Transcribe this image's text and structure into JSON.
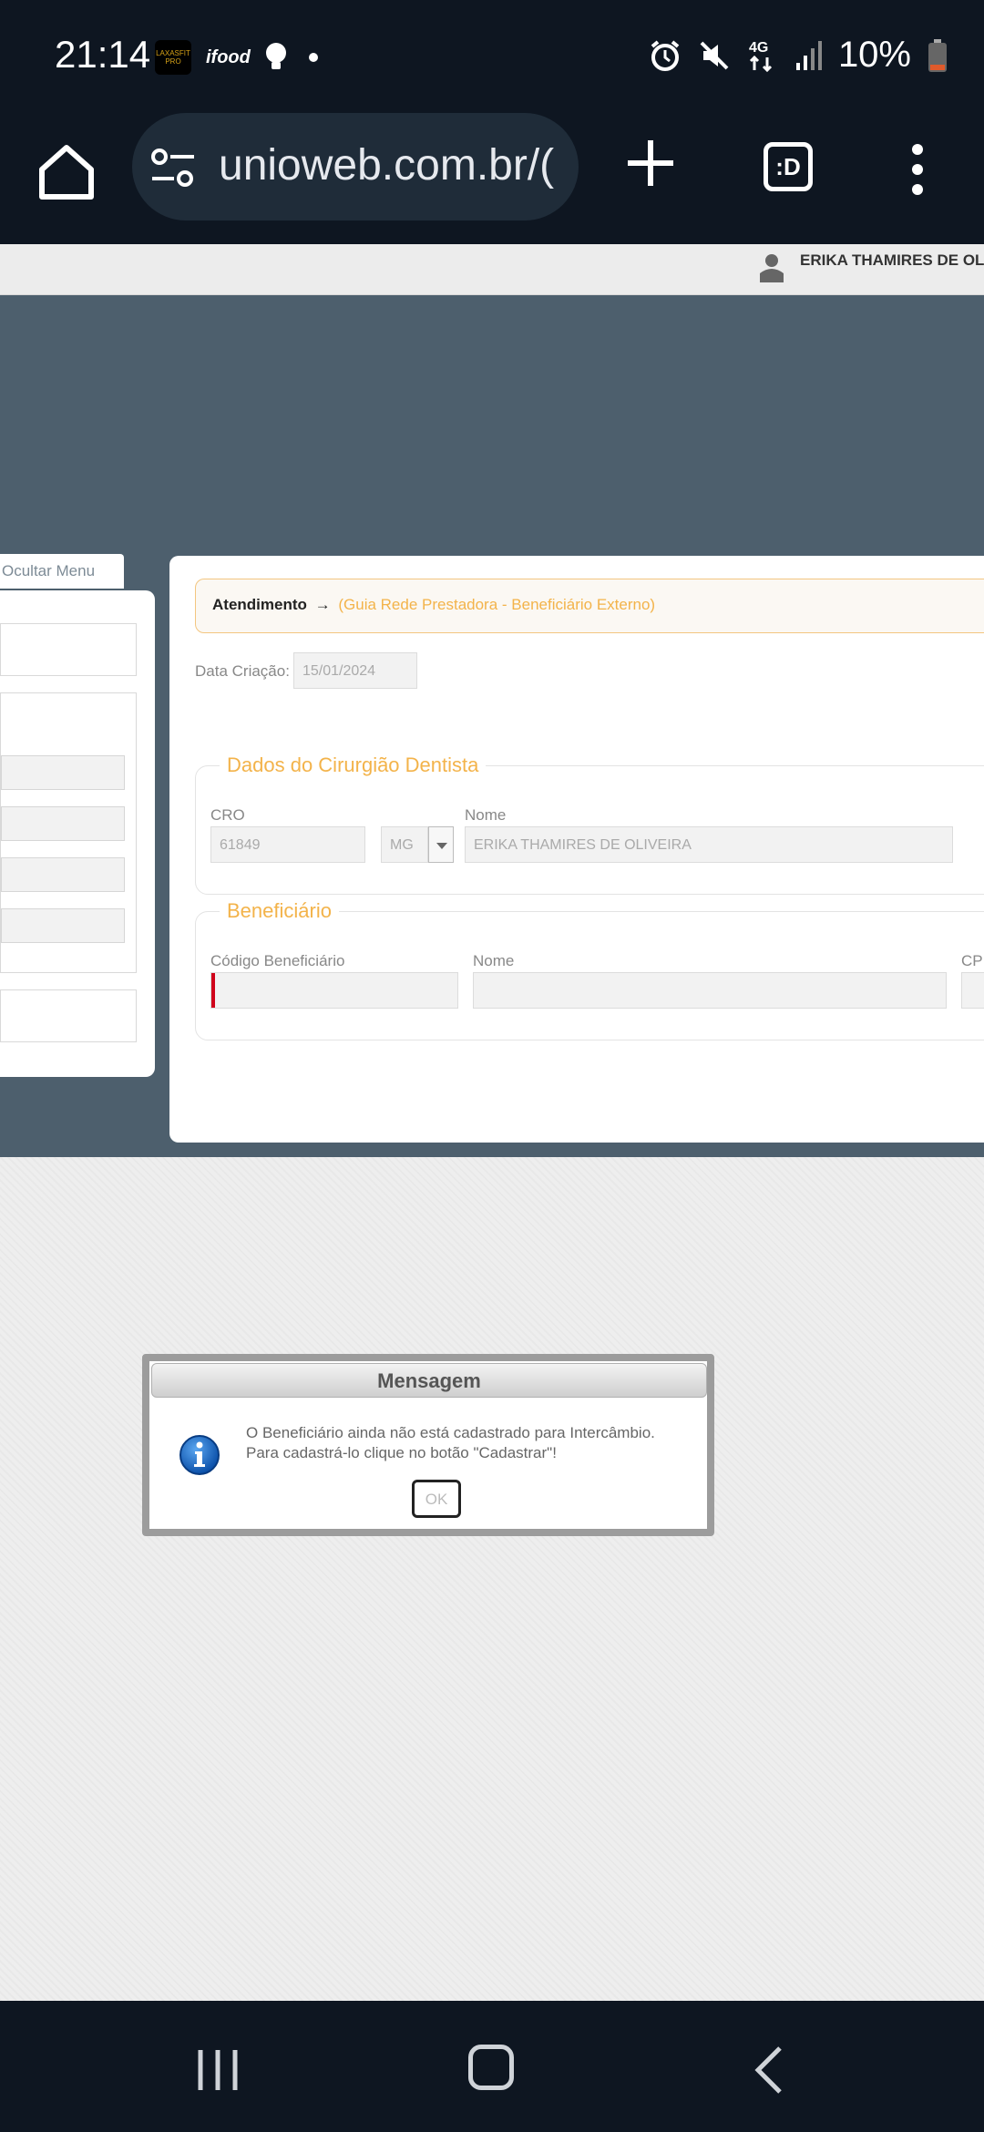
{
  "status_bar": {
    "time": "21:14",
    "app_badge_text": "LAXASFIT PRO",
    "ifood_label": "ifood",
    "battery": "10%",
    "network": "4G",
    "icons": [
      "alarm-icon",
      "mute-icon",
      "network-4g-icon",
      "signal-icon",
      "battery-icon"
    ]
  },
  "browser": {
    "url": "unioweb.com.br/(",
    "tab_switcher_label": ":D",
    "icons": [
      "home-icon",
      "site-settings-icon",
      "new-tab-icon",
      "tab-switcher-icon",
      "more-menu-icon"
    ]
  },
  "header": {
    "user_name": "ERIKA THAMIRES DE OLIVEIRA"
  },
  "sidebar": {
    "hide_menu_label": "Ocultar Menu"
  },
  "main": {
    "breadcrumb": {
      "section": "Atendimento",
      "arrow": "→",
      "page": "(Guia Rede Prestadora - Beneficiário Externo)"
    },
    "creation_date": {
      "label": "Data Criação:",
      "value": "15/01/2024"
    },
    "dentist": {
      "legend": "Dados do Cirurgião Dentista",
      "cro_label": "CRO",
      "cro_value": "61849",
      "uf_value": "MG",
      "name_label": "Nome",
      "name_value": "ERIKA THAMIRES DE OLIVEIRA"
    },
    "beneficiary": {
      "legend": "Beneficiário",
      "code_label": "Código Beneficiário",
      "code_value": "",
      "name_label": "Nome",
      "name_value": "",
      "cpf_label": "CP"
    }
  },
  "dialog": {
    "title": "Mensagem",
    "line1": "O Beneficiário ainda não está cadastrado para Intercâmbio.",
    "line2": "Para cadastrá-lo clique no botão \"Cadastrar\"!",
    "ok_label": "OK"
  },
  "colors": {
    "accent_orange": "#f3b34a",
    "panel_blue": "#4d5f6d",
    "system_bar": "#0e1621"
  }
}
